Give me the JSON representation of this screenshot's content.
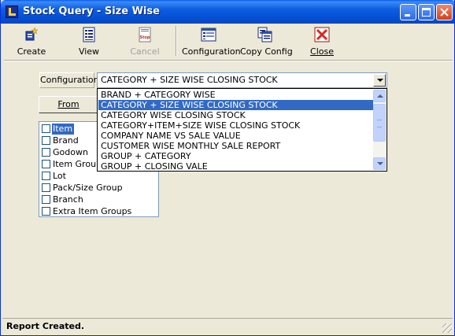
{
  "window": {
    "title": "Stock Query - Size Wise"
  },
  "toolbar": {
    "items": [
      {
        "label": "Create",
        "icon": "create-icon",
        "enabled": true
      },
      {
        "label": "View",
        "icon": "view-icon",
        "enabled": true
      },
      {
        "label": "Cancel",
        "icon": "stop-icon",
        "enabled": false
      },
      {
        "label": "Configuration",
        "icon": "configuration-icon",
        "enabled": true
      },
      {
        "label": "Copy Config",
        "icon": "copy-config-icon",
        "enabled": true
      },
      {
        "label": "Close",
        "icon": "close-x-icon",
        "enabled": true
      }
    ],
    "stop_badge_text": "Stop"
  },
  "config": {
    "label": "Configuration",
    "selected": "CATEGORY + SIZE WISE CLOSING STOCK",
    "options": [
      "BRAND + CATEGORY WISE",
      "CATEGORY + SIZE WISE CLOSING STOCK",
      "CATEGORY WISE CLOSING STOCK",
      "CATEGORY+ITEM+SIZE WISE CLOSING STOCK",
      "COMPANY NAME VS SALE VALUE",
      "CUSTOMER WISE MONTHLY SALE REPORT",
      "GROUP + CATEGORY",
      "GROUP + CLOSING VALE"
    ]
  },
  "from_button": {
    "label": "From"
  },
  "groups": [
    {
      "label": "Item",
      "selected": true
    },
    {
      "label": "Brand",
      "selected": false
    },
    {
      "label": "Godown",
      "selected": false
    },
    {
      "label": "Item Group",
      "selected": false
    },
    {
      "label": "Lot",
      "selected": false
    },
    {
      "label": "Pack/Size Group",
      "selected": false
    },
    {
      "label": "Branch",
      "selected": false
    },
    {
      "label": "Extra Item Groups",
      "selected": false
    }
  ],
  "status": {
    "message": "Report Created."
  },
  "colors": {
    "title_blue": "#0552D6",
    "selection": "#316AC5",
    "face": "#ECE9D8",
    "close_red": "#D3411C"
  }
}
